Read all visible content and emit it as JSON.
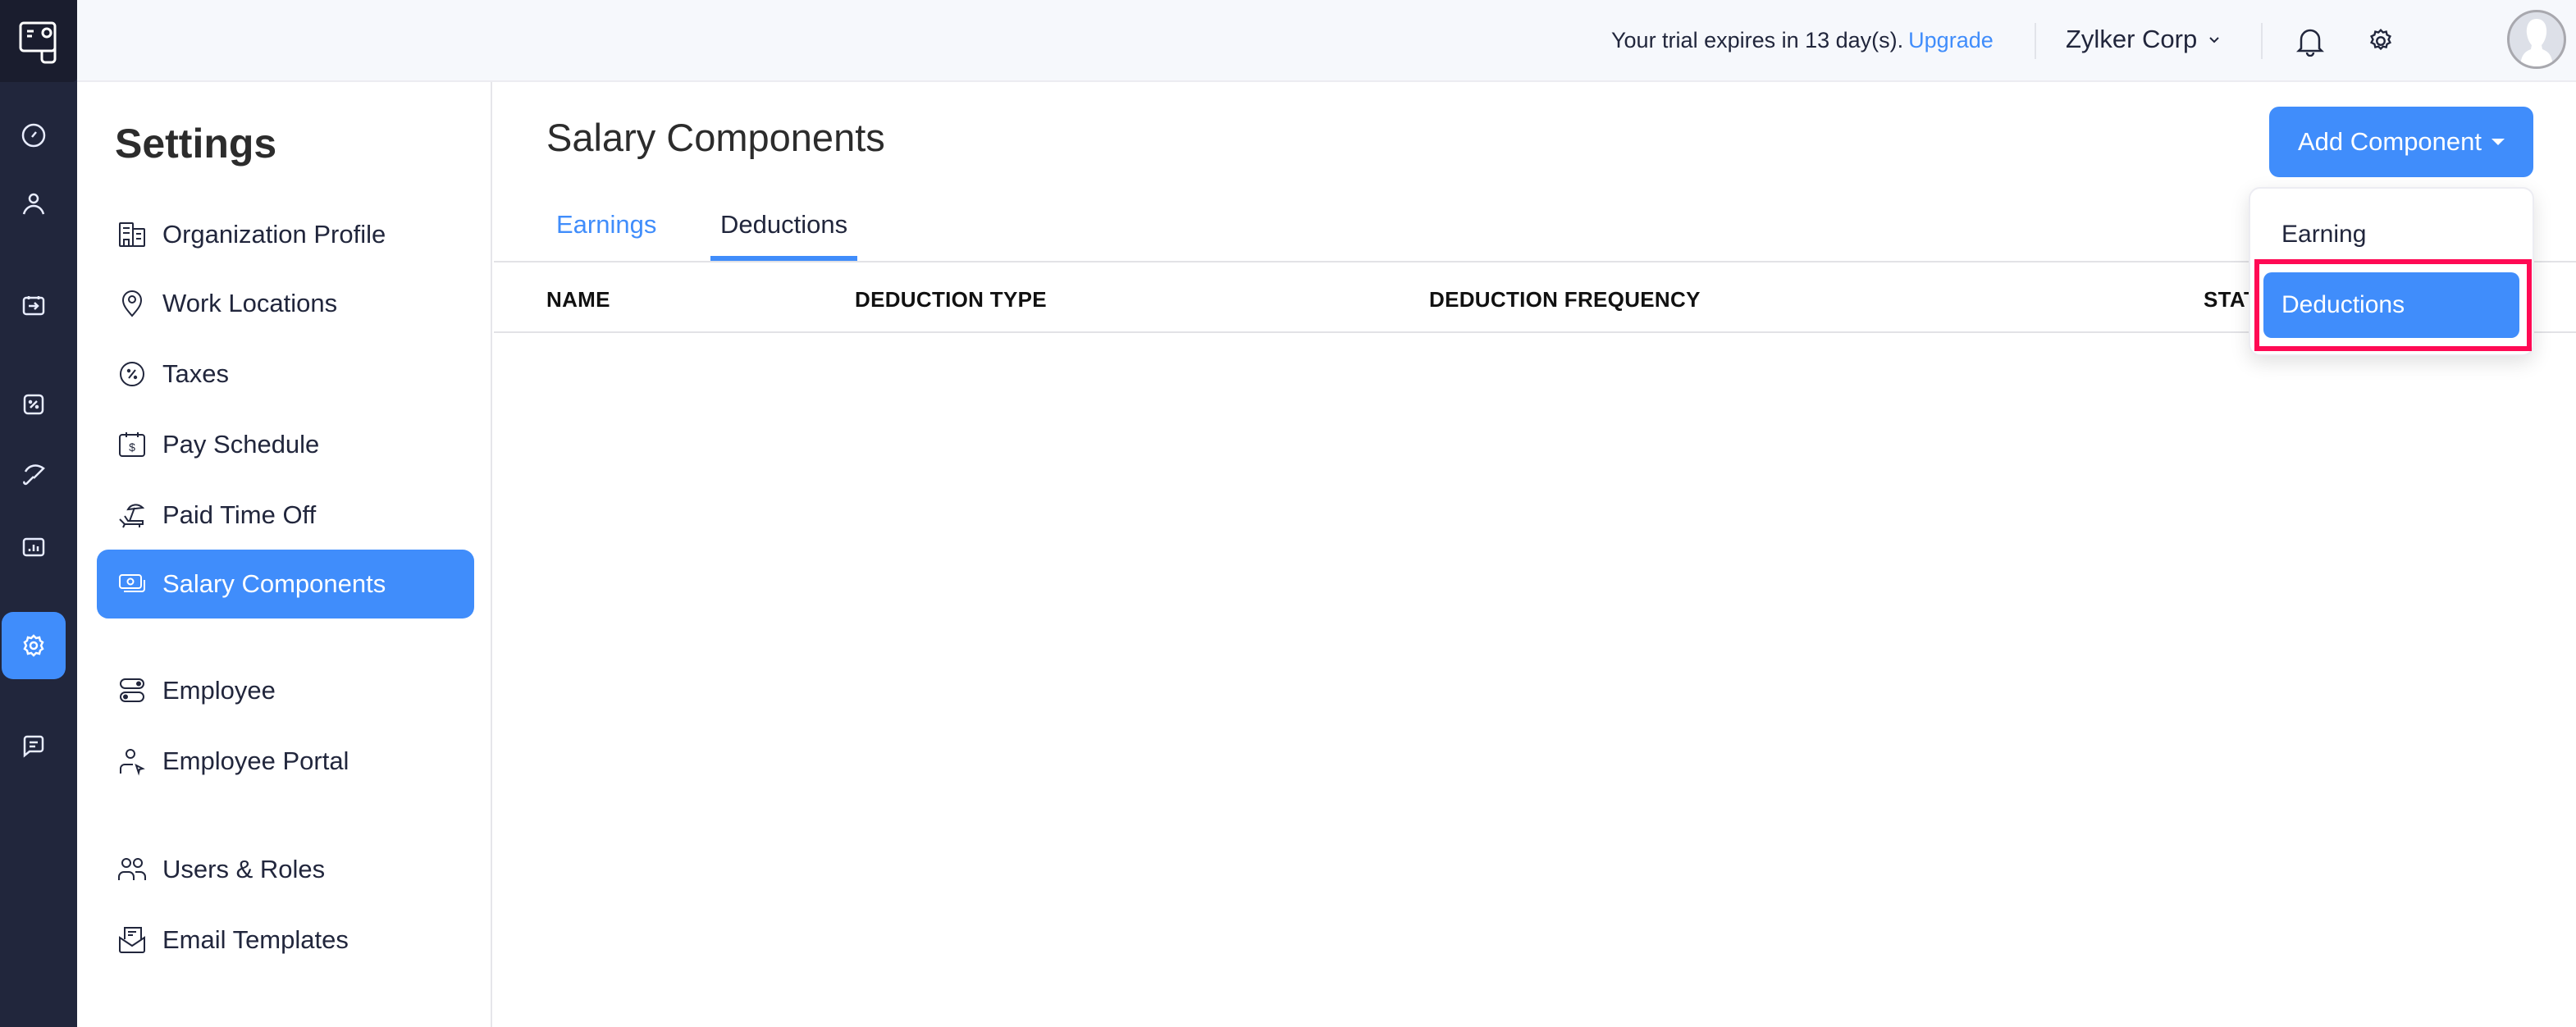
{
  "rail": {
    "items": [
      {
        "name": "dashboard",
        "icon": "gauge-icon"
      },
      {
        "name": "employees",
        "icon": "person-icon"
      },
      {
        "name": "pay-runs",
        "icon": "calendar-arrow-icon"
      },
      {
        "name": "taxes",
        "icon": "percent-icon"
      },
      {
        "name": "benefits",
        "icon": "umbrella-icon"
      },
      {
        "name": "reports",
        "icon": "bar-chart-icon"
      },
      {
        "name": "settings",
        "icon": "gear-icon",
        "active": true
      },
      {
        "name": "feedback",
        "icon": "chat-icon"
      }
    ]
  },
  "header": {
    "trial_text": "Your trial expires in 13 day(s).",
    "upgrade_link": "Upgrade",
    "org_name": "Zylker Corp",
    "accent": "#408dfb"
  },
  "settings": {
    "title": "Settings",
    "items": [
      {
        "label": "Organization Profile",
        "icon": "building-icon"
      },
      {
        "label": "Work Locations",
        "icon": "location-pin-icon"
      },
      {
        "label": "Taxes",
        "icon": "percent-badge-icon"
      },
      {
        "label": "Pay Schedule",
        "icon": "calendar-dollar-icon"
      },
      {
        "label": "Paid Time Off",
        "icon": "beach-chair-icon"
      },
      {
        "label": "Salary Components",
        "icon": "money-icon",
        "active": true
      },
      {
        "label": "Employee",
        "icon": "toggles-icon"
      },
      {
        "label": "Employee Portal",
        "icon": "user-cursor-icon"
      },
      {
        "label": "Users & Roles",
        "icon": "users-icon"
      },
      {
        "label": "Email Templates",
        "icon": "email-open-icon"
      }
    ]
  },
  "main": {
    "title": "Salary Components",
    "tabs": [
      {
        "label": "Earnings",
        "active": false
      },
      {
        "label": "Deductions",
        "active": true
      }
    ],
    "columns": [
      "NAME",
      "DEDUCTION TYPE",
      "DEDUCTION FREQUENCY",
      "STATUS"
    ],
    "rows": []
  },
  "add_component": {
    "label": "Add Component",
    "menu": [
      {
        "label": "Earning",
        "highlighted": false
      },
      {
        "label": "Deductions",
        "highlighted": true
      }
    ],
    "highlight_color": "#ff0a54"
  }
}
